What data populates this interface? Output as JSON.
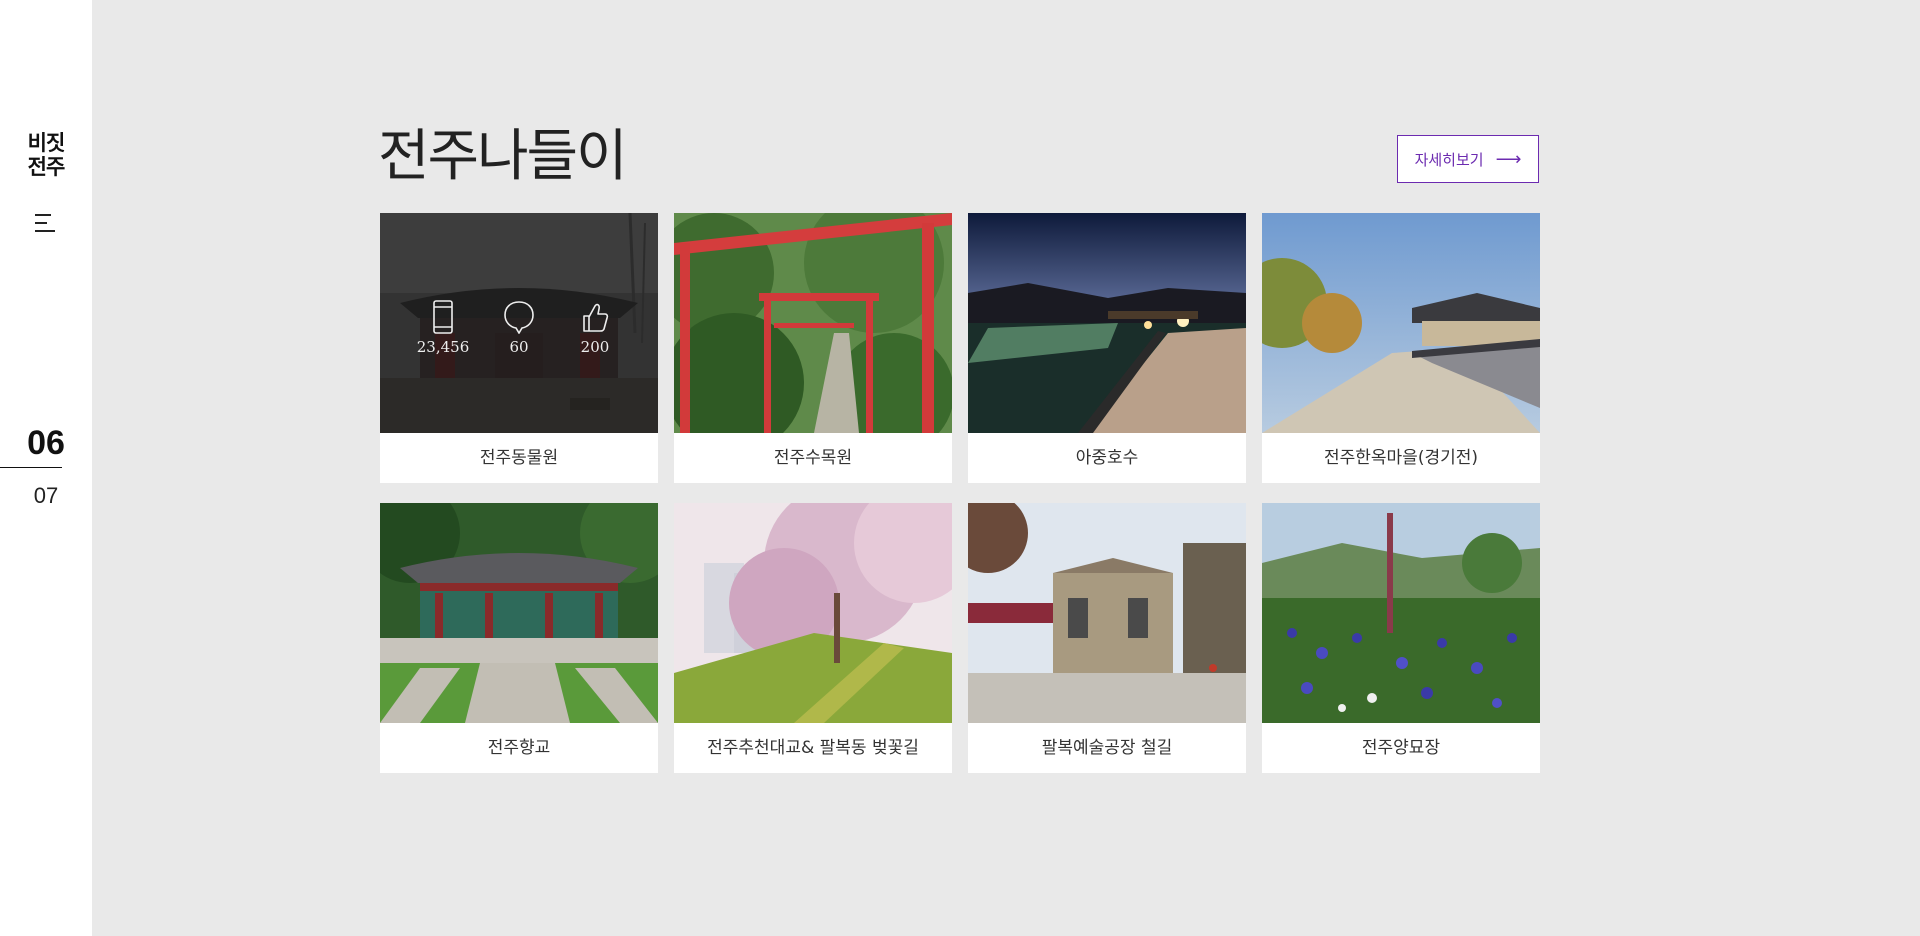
{
  "sidebar": {
    "logo_line1": "비짓",
    "logo_line2": "전주",
    "menu_icon": "hamburger-icon",
    "page_current": "06",
    "page_next": "07"
  },
  "main": {
    "title": "전주나들이",
    "more_label": "자세히보기",
    "more_arrow": "⟶"
  },
  "stats": {
    "views": "23,456",
    "comments": "60",
    "likes": "200"
  },
  "cards": [
    {
      "label": "전주동물원",
      "image": "jeonju-zoo-gate-photo"
    },
    {
      "label": "전주수목원",
      "image": "red-arches-garden-photo"
    },
    {
      "label": "아중호수",
      "image": "night-lake-boardwalk-photo"
    },
    {
      "label": "전주한옥마을(경기전)",
      "image": "hanok-village-wall-photo"
    },
    {
      "label": "전주향교",
      "image": "hyanggyo-hall-photo"
    },
    {
      "label": "전주추천대교& 팔복동 벚꽃길",
      "image": "cherry-blossom-road-photo"
    },
    {
      "label": "팔복예술공장 철길",
      "image": "art-factory-buildings-photo"
    },
    {
      "label": "전주양묘장",
      "image": "cornflower-field-photo"
    }
  ],
  "colors": {
    "accent": "#6c2bb0",
    "background": "#e9e9e9"
  }
}
